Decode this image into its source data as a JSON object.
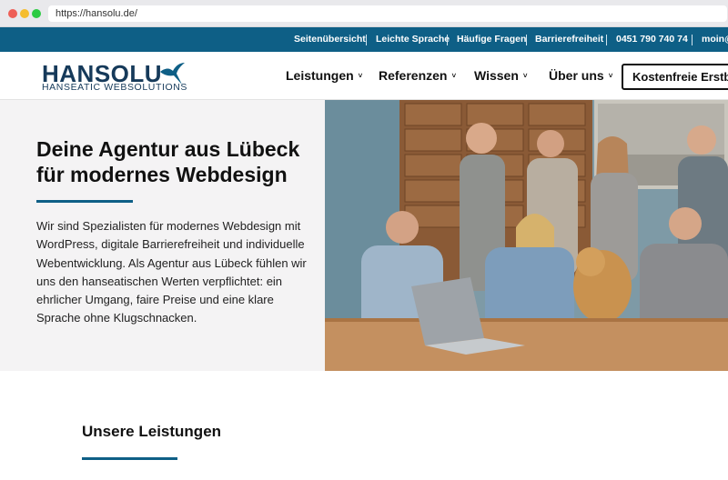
{
  "browser": {
    "url": "https://hansolu.de/"
  },
  "topbar": {
    "items": [
      {
        "label": "Seitenübersicht"
      },
      {
        "label": "Leichte Sprache"
      },
      {
        "label": "Häufige Fragen"
      },
      {
        "label": "Barrierefreiheit"
      },
      {
        "label": "0451 790 740 74"
      },
      {
        "label": "moin@"
      }
    ]
  },
  "header": {
    "logo_name": "HANSOLU",
    "logo_tagline": "HANSEATIC WEBSOLUTIONS",
    "nav": [
      {
        "label": "Leistungen"
      },
      {
        "label": "Referenzen"
      },
      {
        "label": "Wissen"
      },
      {
        "label": "Über uns"
      }
    ],
    "chevron": "˅",
    "cta_label": "Kostenfreie Erstbe"
  },
  "hero": {
    "title": "Deine Agentur aus Lübeck für modernes Webdesign",
    "text": "Wir sind Spezialisten für modernes Webdesign mit WordPress, digitale Barrierefreiheit und individuelle Webentwicklung. Als Agentur aus Lübeck fühlen wir uns den hanseatischen Werten verpflichtet: ein ehrlicher Umgang, faire Preise und eine klare Sprache ohne Klugschnacken."
  },
  "services": {
    "title": "Unsere Leistungen"
  },
  "colors": {
    "brand_blue": "#0e5f86",
    "logo_navy": "#163a5a",
    "hero_bg": "#f4f3f4"
  }
}
